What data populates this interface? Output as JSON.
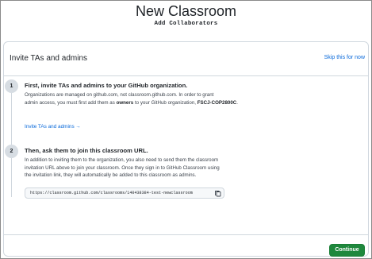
{
  "header": {
    "title": "New Classroom",
    "subtitle": "Add Collaborators"
  },
  "card": {
    "title": "Invite TAs and admins",
    "skip_label": "Skip this for now"
  },
  "steps": [
    {
      "number": "1",
      "title": "First, invite TAs and admins to your GitHub organization.",
      "body_line1": "Organizations are managed on github.com, not classroom.github.com. In order to grant",
      "body_line2_pre": "admin access, you must first add them as ",
      "body_line2_bold": "owners",
      "body_line2_post": " to your GitHub organization, ",
      "org_name": "FSCJ-COP2800C",
      "link_label": "Invite TAs and admins →"
    },
    {
      "number": "2",
      "title": "Then, ask them to join this classroom URL.",
      "body_line1": "In addition to inviting them to the organization, you also need to send them the classroom",
      "body_line2": "invitation URL above to join your classroom. Once they sign in to GitHub Classroom using",
      "body_line3": "the invitation link, they will automatically be added to this classroom as admins.",
      "url": "https://classroom.github.com/classrooms/140438384-test-newclassroom"
    }
  ],
  "footer": {
    "continue_label": "Continue"
  },
  "icons": {
    "copy": "copy-icon"
  },
  "colors": {
    "link": "#0969da",
    "primary_button": "#1f883d",
    "step_circle": "#d7dde3"
  }
}
